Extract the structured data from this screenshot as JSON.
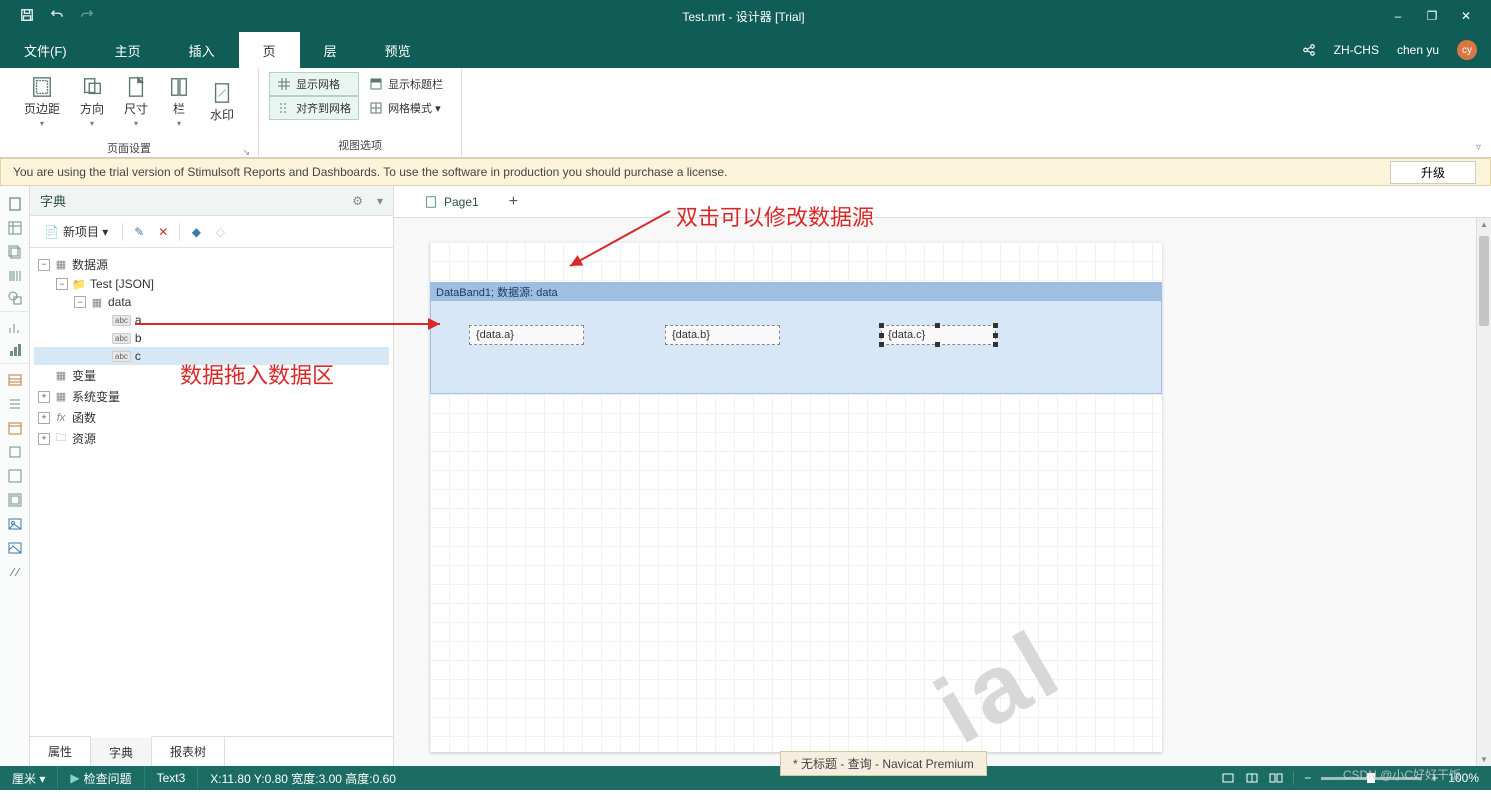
{
  "title": "Test.mrt - 设计器 [Trial]",
  "qat": {
    "save": "保存",
    "undo": "撤销",
    "redo": "重做"
  },
  "window_controls": {
    "minimize": "–",
    "restore": "❐",
    "close": "✕"
  },
  "menu": {
    "items": [
      "文件(F)",
      "主页",
      "插入",
      "页",
      "层",
      "预览"
    ],
    "active_index": 3,
    "language": "ZH-CHS",
    "user": "chen yu",
    "avatar": "cy",
    "share": "分享"
  },
  "ribbon": {
    "group_page": {
      "label": "页面设置",
      "margins": "页边距",
      "orientation": "方向",
      "size": "尺寸",
      "columns": "栏",
      "watermark": "水印"
    },
    "group_view": {
      "label": "视图选项",
      "show_grid": "显示网格",
      "show_title": "显示标题栏",
      "align_grid": "对齐到网格",
      "grid_mode": "网格模式 ▾"
    },
    "collapse": "▿"
  },
  "trial": {
    "message": "You are using the trial version of Stimulsoft Reports and Dashboards. To use the software in production you should purchase a license.",
    "upgrade": "升级"
  },
  "dict": {
    "title": "字典",
    "new_item": "新项目 ▾",
    "tree": {
      "datasource": "数据源",
      "test_json": "Test [JSON]",
      "data": "data",
      "fields": [
        "a",
        "b",
        "c"
      ],
      "variables": "变量",
      "sysvars": "系统变量",
      "functions": "函数",
      "resources": "资源"
    },
    "tabs": {
      "properties": "属性",
      "dictionary": "字典",
      "report_tree": "报表树",
      "active": 1
    }
  },
  "page_tabs": {
    "page1": "Page1",
    "add": "+"
  },
  "databand": {
    "header": "DataBand1; 数据源: data",
    "fields": [
      "{data.a}",
      "{data.b}",
      "{data.c}"
    ]
  },
  "annotations": {
    "top": "双击可以修改数据源",
    "left": "数据拖入数据区"
  },
  "status": {
    "unit": "厘米 ▾",
    "check": "检查问题",
    "element": "Text3",
    "coords": "X:11.80 Y:0.80 宽度:3.00 高度:0.60",
    "zoom": "100%"
  },
  "taskbar": "* 无标题 - 查询 - Navicat Premium",
  "csdn": "CSDN @小C好好干饭",
  "watermark_text": "ial"
}
